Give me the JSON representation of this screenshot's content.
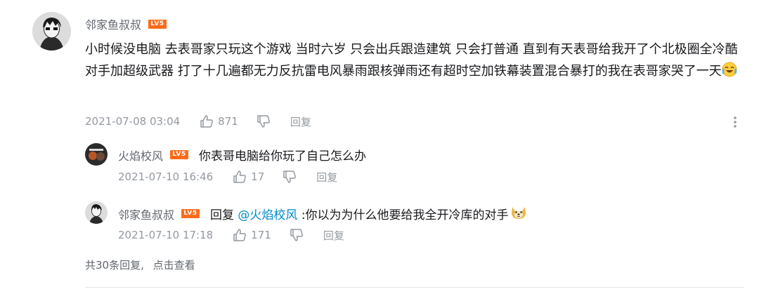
{
  "comment": {
    "username": "邻家鱼叔叔",
    "level": "LV5",
    "text": "小时候没电脑 去表哥家只玩这个游戏 当时六岁 只会出兵跟造建筑 只会打普通 直到有天表哥给我开了个北极圈全冷酷对手加超级武器 打了十几遍都无力反抗雷电风暴雨跟核弹雨还有超时空加铁幕装置混合暴打的我在表哥家哭了一天",
    "emoji": "crying-laughing",
    "time": "2021-07-08 03:04",
    "likes": "871",
    "reply_label": "回复"
  },
  "replies": [
    {
      "username": "火焰校风",
      "level": "LV5",
      "text": "你表哥电脑给你玩了自己怎么办",
      "time": "2021-07-10 16:46",
      "likes": "17",
      "reply_label": "回复"
    },
    {
      "username": "邻家鱼叔叔",
      "level": "LV5",
      "prefix": "回复 ",
      "mention": "@火焰校风",
      "text": " :你以为为什么他要给我全开冷库的对手",
      "emoji": "doge",
      "time": "2021-07-10 17:18",
      "likes": "171",
      "reply_label": "回复"
    }
  ],
  "more_replies": {
    "count_text": "共30条回复,",
    "action": "点击查看"
  },
  "colors": {
    "level_badge": "#ff6b1a",
    "link": "#008ac5",
    "meta": "#9499a0"
  }
}
